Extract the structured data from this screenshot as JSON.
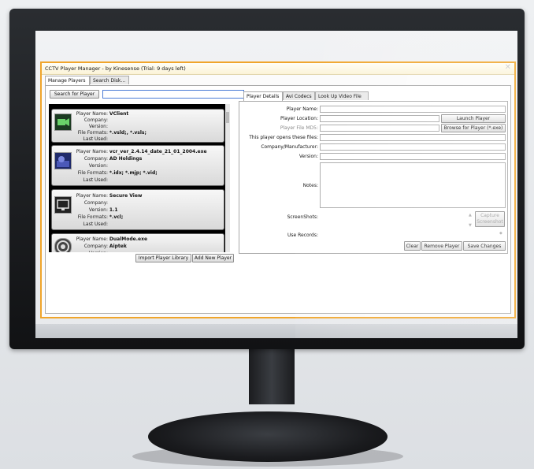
{
  "window": {
    "title": "CCTV Player Manager - by Kinesense (Trial: 9 days left)",
    "close_glyph": "✕",
    "tabs": [
      "Manage Players",
      "Search Disk..."
    ]
  },
  "search": {
    "button_label": "Search for Player",
    "value": ""
  },
  "players": [
    {
      "name": "VClient",
      "company": "",
      "version": "",
      "formats": "*.vsld;, *.vsls;",
      "last_used": ""
    },
    {
      "name": "vcr_ver_2.4.14_date_21_01_2004.exe",
      "company": "AD Holdings",
      "version": "",
      "formats": "*.idx; *.mjp; *.vid;",
      "last_used": ""
    },
    {
      "name": "Secure View",
      "company": "",
      "version": "1.1",
      "formats": "*.vcl;",
      "last_used": ""
    },
    {
      "name": "DualMode.exe",
      "company": "Aiptek",
      "version": "",
      "formats": "",
      "last_used": ""
    }
  ],
  "player_labels": {
    "name": "Player Name:",
    "company": "Company:",
    "version": "Version:",
    "formats": "File Formats:",
    "last_used": "Last Used:"
  },
  "list_buttons": {
    "import": "Import Player Library",
    "add": "Add New Player"
  },
  "details": {
    "tabs": [
      "Player Details",
      "Avi Codecs",
      "Look Up Video File"
    ],
    "labels": {
      "player_name": "Player Name:",
      "player_location": "Player Location:",
      "player_md5": "Player File MD5:",
      "opens_files": "This player opens these files:",
      "company": "Company/Manufacturer:",
      "version": "Version:",
      "notes": "Notes:",
      "screenshots": "ScreenShots:",
      "use_records": "Use Records:"
    },
    "buttons": {
      "launch": "Launch Player",
      "browse": "Browse for Player (*.exe)",
      "capture_line1": "Capture",
      "capture_line2": "Screenshot",
      "clear": "Clear",
      "remove": "Remove Player",
      "save": "Save Changes"
    }
  },
  "colors": {
    "window_border": "#f0a52b",
    "accent_blue": "#4d7dd6",
    "list_background": "#000000"
  }
}
